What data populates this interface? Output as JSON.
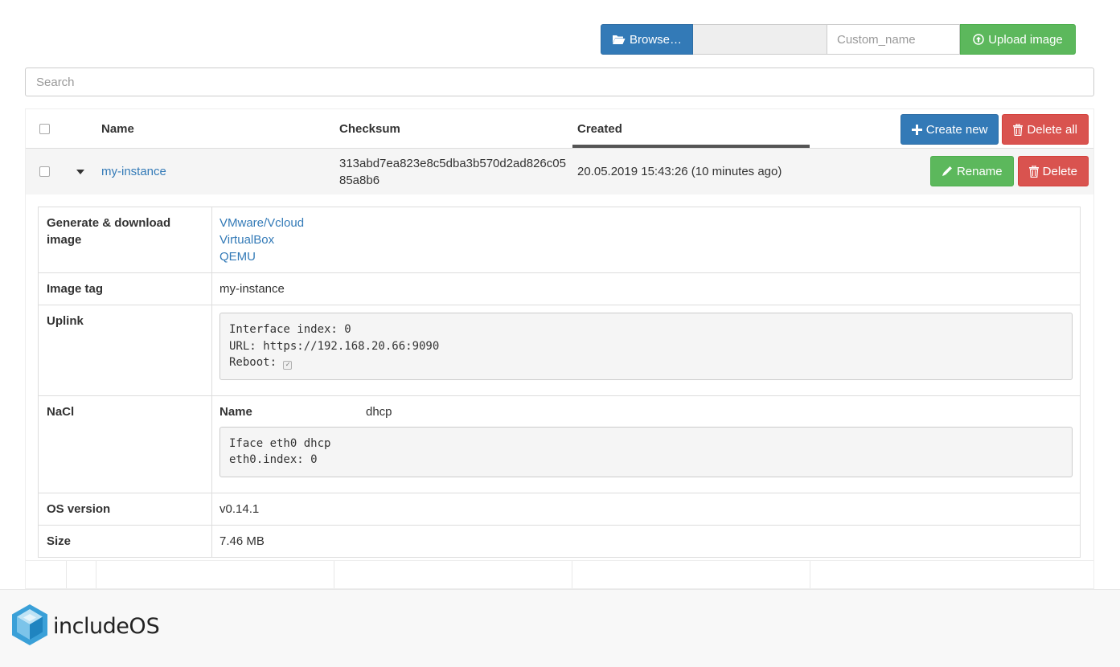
{
  "upload": {
    "browse_label": "Browse…",
    "custom_name_placeholder": "Custom_name",
    "upload_label": "Upload image"
  },
  "search": {
    "placeholder": "Search"
  },
  "table": {
    "columns": {
      "name": "Name",
      "checksum": "Checksum",
      "created": "Created"
    },
    "create_label": "Create new",
    "delete_all_label": "Delete all"
  },
  "row": {
    "name": "my-instance",
    "checksum": "313abd7ea823e8c5dba3b570d2ad826c0585a8b6",
    "created": "20.05.2019 15:43:26 (10 minutes ago)",
    "rename_label": "Rename",
    "delete_label": "Delete"
  },
  "detail": {
    "generate_label": "Generate & download image",
    "downloads": [
      "VMware/Vcloud",
      "VirtualBox",
      "QEMU"
    ],
    "image_tag_label": "Image tag",
    "image_tag": "my-instance",
    "uplink_label": "Uplink",
    "uplink_interface": "Interface index: 0",
    "uplink_url": "URL: https://192.168.20.66:9090",
    "uplink_reboot": "Reboot:",
    "uplink_reboot_checked": true,
    "nacl_label": "NaCl",
    "nacl_name_label": "Name",
    "nacl_name": "dhcp",
    "nacl_line1": "Iface eth0 dhcp",
    "nacl_line2": "eth0.index: 0",
    "os_label": "OS version",
    "os_version": "v0.14.1",
    "size_label": "Size",
    "size": "7.46 MB"
  },
  "footer": {
    "logo_include": "include",
    "logo_os": "OS"
  },
  "colors": {
    "primary": "#337ab7",
    "success": "#5cb85c",
    "danger": "#d9534f",
    "link": "#337ab7",
    "logo_blue": "#3aa0d8"
  },
  "icons": {
    "browse": "folder-open-icon",
    "upload": "upload-circle-icon",
    "create": "plus-icon",
    "delete": "trash-icon",
    "rename": "pencil-icon",
    "expand": "caret-down-icon"
  }
}
